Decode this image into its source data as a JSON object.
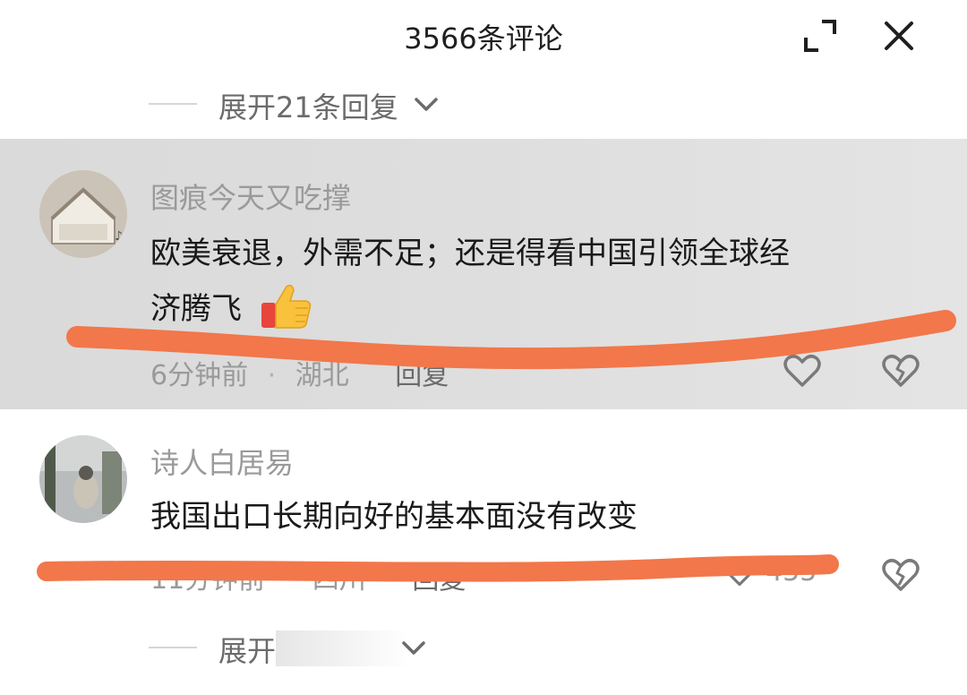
{
  "header": {
    "title": "3566条评论"
  },
  "top_expand": {
    "label": "展开21条回复"
  },
  "comments": [
    {
      "author": "图痕今天又吃撑",
      "text_line1": "欧美衰退，外需不足；还是得看中国引领全球经",
      "text_line2": "济腾飞",
      "time": "6分钟前",
      "sep": "·",
      "location": "湖北",
      "reply": "回复",
      "emoji": "thumbs-up-icon"
    },
    {
      "author": "诗人白居易",
      "text": "我国出口长期向好的基本面没有改变",
      "time": "11分钟前",
      "sep": "·",
      "location": "四川",
      "reply": "回复",
      "likes": "455"
    }
  ],
  "bottom_expand": {
    "label": "展开"
  },
  "colors": {
    "scribble": "#f2774a",
    "highlight_bg": "#dcdcdc",
    "meta_text": "#9a9a9a"
  }
}
